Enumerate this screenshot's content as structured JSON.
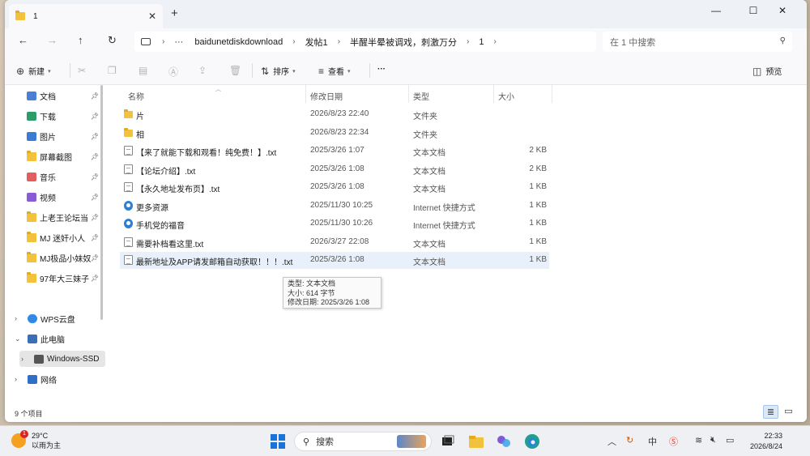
{
  "tab": {
    "title": "1",
    "close": "✕",
    "new": "+"
  },
  "window_controls": {
    "minimize": "—",
    "maximize": "☐",
    "close": "✕"
  },
  "address": {
    "more": "···",
    "segments": [
      "baidunetdiskdownload",
      "发帖1",
      "半醒半晕被调戏，刺激万分",
      "1"
    ]
  },
  "search": {
    "placeholder": "在 1 中搜索"
  },
  "toolbar": {
    "new_label": "新建",
    "sort_label": "排序",
    "view_label": "查看",
    "more_label": "···",
    "preview_label": "预览"
  },
  "sidebar": {
    "quick": [
      {
        "label": "文档",
        "icon": "document-icon"
      },
      {
        "label": "下载",
        "icon": "download-icon"
      },
      {
        "label": "图片",
        "icon": "picture-icon"
      },
      {
        "label": "屏幕截图",
        "icon": "folder-icon"
      },
      {
        "label": "音乐",
        "icon": "music-icon"
      },
      {
        "label": "视频",
        "icon": "video-icon"
      },
      {
        "label": "上老王论坛当",
        "icon": "folder-icon"
      },
      {
        "label": "MJ 迷奸小人",
        "icon": "folder-icon"
      },
      {
        "label": "MJ极品小妹奴",
        "icon": "folder-icon"
      },
      {
        "label": "97年大三妹子",
        "icon": "folder-icon"
      }
    ],
    "roots": [
      {
        "label": "WPS云盘",
        "icon": "cloud-icon",
        "expand": "›"
      },
      {
        "label": "此电脑",
        "icon": "computer-icon",
        "expand": "⌄"
      },
      {
        "label": "Windows-SSD",
        "icon": "drive-icon",
        "expand": "›"
      },
      {
        "label": "网络",
        "icon": "network-icon",
        "expand": "›"
      }
    ]
  },
  "columns": {
    "name": "名称",
    "modified": "修改日期",
    "type": "类型",
    "size": "大小"
  },
  "files": [
    {
      "name": "片",
      "modified": "2026/8/23 22:40",
      "type": "文件夹",
      "size": "",
      "icon": "folder-icon"
    },
    {
      "name": "相",
      "modified": "2026/8/23 22:34",
      "type": "文件夹",
      "size": "",
      "icon": "folder-icon"
    },
    {
      "name": "【来了就能下载和观看！纯免费！】.txt",
      "modified": "2025/3/26 1:07",
      "type": "文本文档",
      "size": "2 KB",
      "icon": "text-file-icon"
    },
    {
      "name": "【论坛介绍】.txt",
      "modified": "2025/3/26 1:08",
      "type": "文本文档",
      "size": "2 KB",
      "icon": "text-file-icon"
    },
    {
      "name": "【永久地址发布页】.txt",
      "modified": "2025/3/26 1:08",
      "type": "文本文档",
      "size": "1 KB",
      "icon": "text-file-icon"
    },
    {
      "name": "更多资源",
      "modified": "2025/11/30 10:25",
      "type": "Internet 快捷方式",
      "size": "1 KB",
      "icon": "internet-shortcut-icon"
    },
    {
      "name": "手机党的福音",
      "modified": "2025/11/30 10:26",
      "type": "Internet 快捷方式",
      "size": "1 KB",
      "icon": "internet-shortcut-icon"
    },
    {
      "name": "需要补档看这里.txt",
      "modified": "2026/3/27 22:08",
      "type": "文本文档",
      "size": "1 KB",
      "icon": "text-file-icon"
    },
    {
      "name": "最新地址及APP请发邮箱自动获取！！！.txt",
      "modified": "2025/3/26 1:08",
      "type": "文本文档",
      "size": "1 KB",
      "icon": "text-file-icon"
    }
  ],
  "tooltip": {
    "type": "类型: 文本文档",
    "size": "大小: 614 字节",
    "modified": "修改日期: 2025/3/26 1:08"
  },
  "status": {
    "count": "9 个项目"
  },
  "taskbar": {
    "weather_temp": "29°C",
    "weather_desc": "以雨为主",
    "weather_badge": "1",
    "search_label": "搜索",
    "ime_label": "中",
    "time": "22:33",
    "date": "2026/8/24"
  }
}
